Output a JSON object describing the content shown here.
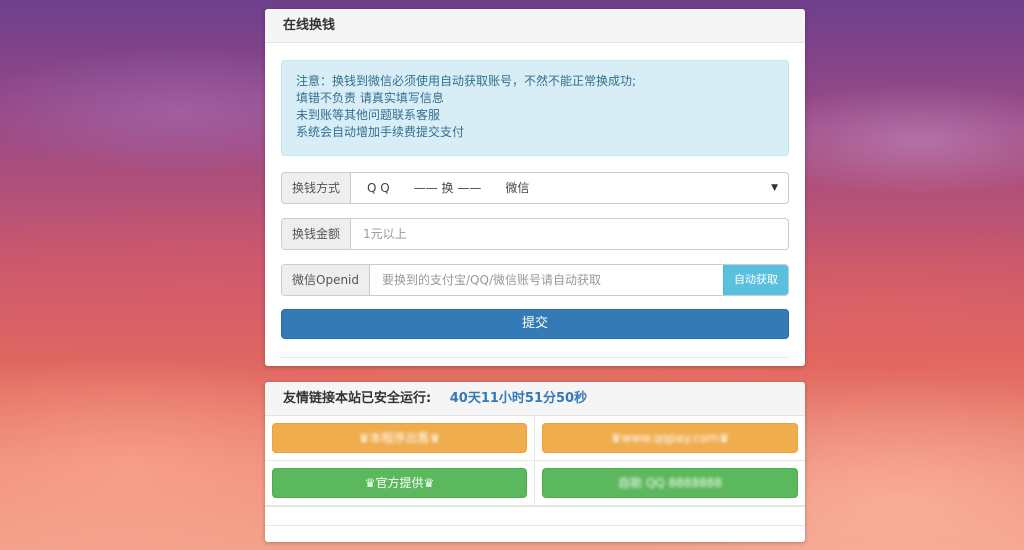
{
  "exchange": {
    "title": "在线换钱",
    "notice": [
      "注意：换钱到微信必须使用自动获取账号，不然不能正常换成功;",
      "填错不负责 请真实填写信息",
      "未到账等其他问题联系客服",
      "系统会自动增加手续费提交支付"
    ],
    "method_label": "换钱方式",
    "method_value": "Q Q　　—— 换 ——　　微信",
    "amount_label": "换钱金额",
    "amount_placeholder": "1元以上",
    "openid_label": "微信Openid",
    "openid_placeholder": "要换到的支付宝/QQ/微信账号请自动获取",
    "auto_button": "自动获取",
    "submit_button": "提交"
  },
  "links": {
    "heading": "友情链接本站已安全运行:",
    "runtime": "40天11小时51分50秒",
    "items": [
      {
        "label": "♛本程序出售♛",
        "color": "orange"
      },
      {
        "label": "♛www.qqpay.com♛",
        "color": "orange"
      },
      {
        "label": "♛官方提供♛",
        "color": "green"
      },
      {
        "label": "自助 QQ 8888888",
        "color": "green"
      }
    ]
  },
  "colors": {
    "primary": "#337ab7",
    "info": "#5bc0de",
    "warning": "#f0ad4e",
    "success": "#5cb85c",
    "alert_bg": "#d9edf7"
  }
}
